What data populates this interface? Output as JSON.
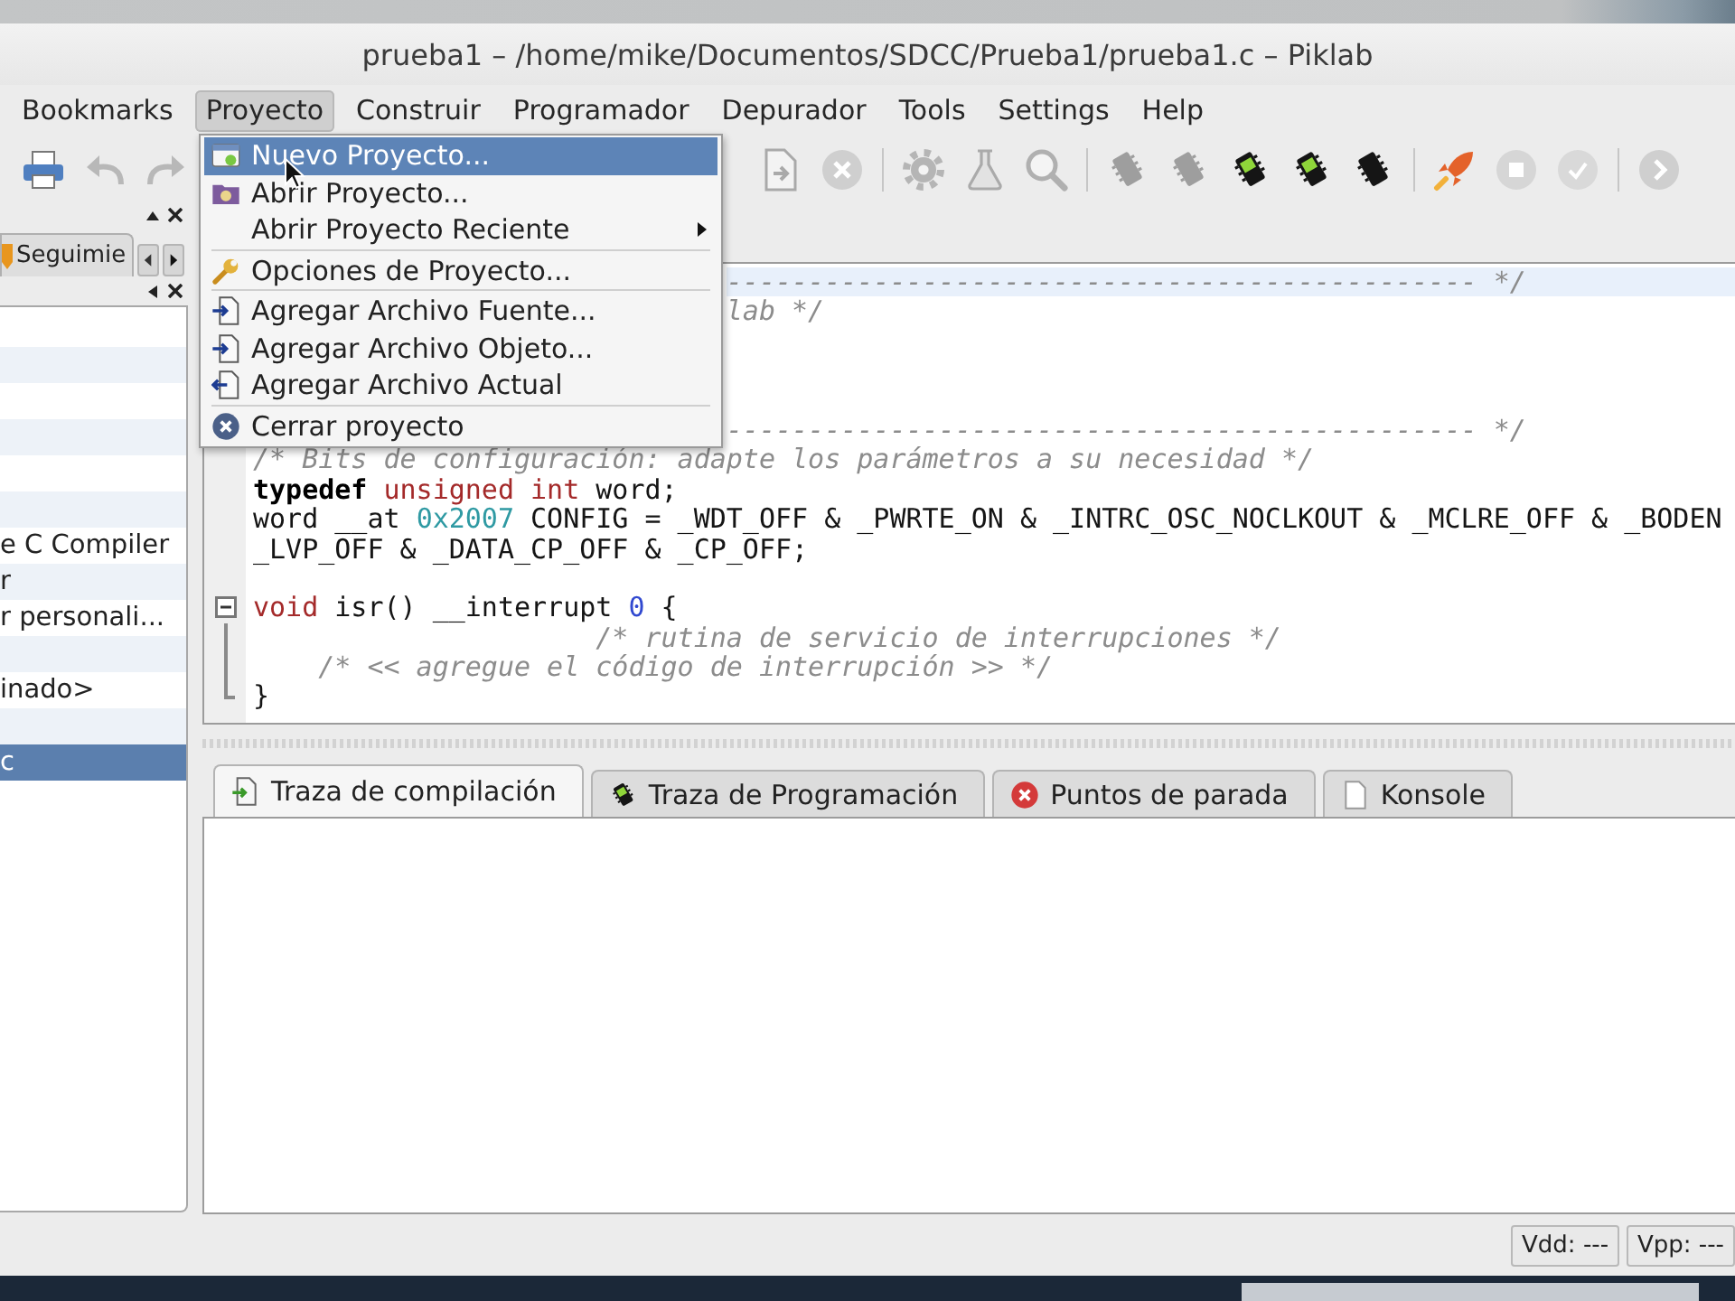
{
  "title_bar": {
    "title": "prueba1 – /home/mike/Documentos/SDCC/Prueba1/prueba1.c – Piklab"
  },
  "menu_bar": [
    {
      "label": "Bookmarks",
      "selected": false
    },
    {
      "label": "Proyecto",
      "selected": true
    },
    {
      "label": "Construir",
      "selected": false
    },
    {
      "label": "Programador",
      "selected": false
    },
    {
      "label": "Depurador",
      "selected": false
    },
    {
      "label": "Tools",
      "selected": false
    },
    {
      "label": "Settings",
      "selected": false
    },
    {
      "label": "Help",
      "selected": false
    }
  ],
  "toolbar": {
    "left": [
      {
        "kind": "print",
        "disabled": false
      },
      {
        "kind": "undo",
        "disabled": true
      },
      {
        "kind": "redo",
        "disabled": true
      }
    ],
    "right": [
      {
        "kind": "document",
        "disabled": true
      },
      {
        "kind": "circle_x",
        "disabled": true
      },
      {
        "kind": "separator"
      },
      {
        "kind": "gear",
        "disabled": true
      },
      {
        "kind": "flask",
        "disabled": true
      },
      {
        "kind": "search",
        "disabled": true
      },
      {
        "kind": "separator"
      },
      {
        "kind": "chip",
        "disabled": true
      },
      {
        "kind": "chip",
        "disabled": true
      },
      {
        "kind": "chip_label",
        "disabled": false
      },
      {
        "kind": "chip_label",
        "disabled": false
      },
      {
        "kind": "chip",
        "disabled": false
      },
      {
        "kind": "separator"
      },
      {
        "kind": "rocket",
        "disabled": false
      },
      {
        "kind": "circle_square",
        "disabled": true
      },
      {
        "kind": "circle_check",
        "disabled": true
      },
      {
        "kind": "separator"
      },
      {
        "kind": "circle_arrow",
        "disabled": true
      }
    ]
  },
  "project_menu": [
    {
      "kind": "item",
      "label": "Nuevo Proyecto...",
      "selected": true
    },
    {
      "kind": "item",
      "label": "Abrir Proyecto...",
      "selected": false
    },
    {
      "kind": "submenu",
      "label": "Abrir Proyecto Reciente",
      "selected": false
    },
    {
      "kind": "separator"
    },
    {
      "kind": "item",
      "label": "Opciones de Proyecto...",
      "selected": false
    },
    {
      "kind": "separator"
    },
    {
      "kind": "item",
      "label": "Agregar Archivo Fuente...",
      "selected": false
    },
    {
      "kind": "item",
      "label": "Agregar Archivo Objeto...",
      "selected": false
    },
    {
      "kind": "item",
      "label": "Agregar Archivo Actual",
      "selected": false
    },
    {
      "kind": "separator"
    },
    {
      "kind": "item",
      "label": "Cerrar proyecto",
      "selected": false
    }
  ],
  "side_panel": {
    "tab": {
      "label": "Seguimie"
    },
    "rows": [
      {
        "selected": false
      },
      {
        "selected": false
      },
      {
        "selected": false
      },
      {
        "selected": false
      },
      {
        "selected": false
      },
      {
        "selected": false
      },
      {
        "label": "e C Compiler",
        "selected": false
      },
      {
        "label": "r",
        "selected": false
      },
      {
        "label": "r personali...",
        "selected": false
      },
      {
        "selected": false
      },
      {
        "label": "inado>",
        "selected": false
      },
      {
        "selected": false
      },
      {
        "label": "c",
        "selected": true
      }
    ]
  },
  "editor": {
    "lines": [
      {
        "kind": "under_menu",
        "current": true,
        "tokens": [
          {
            "kind": "comment",
            "text": "---------------------------------------------- */"
          }
        ]
      },
      {
        "kind": "under_menu",
        "current": false,
        "tokens": [
          {
            "kind": "comment",
            "text": "lab */"
          }
        ]
      },
      {
        "kind": "blank",
        "current": false
      },
      {
        "kind": "blank",
        "current": false
      },
      {
        "kind": "blank",
        "current": false
      },
      {
        "kind": "under_menu",
        "current": false,
        "tokens": [
          {
            "kind": "comment",
            "text": "---------------------------------------------- */"
          }
        ]
      },
      {
        "kind": "code",
        "current": false,
        "tokens": [
          {
            "kind": "comment",
            "text": "/* Bits de configuración: adapte los parámetros a su necesidad */"
          }
        ]
      },
      {
        "kind": "code",
        "current": false,
        "tokens": [
          {
            "kind": "keyword",
            "text": "typedef "
          },
          {
            "kind": "type",
            "text": "unsigned int"
          },
          {
            "kind": "plain",
            "text": " word;"
          }
        ]
      },
      {
        "kind": "code",
        "current": false,
        "tokens": [
          {
            "kind": "plain",
            "text": "word __at "
          },
          {
            "kind": "hex",
            "text": "0x2007"
          },
          {
            "kind": "plain",
            "text": " CONFIG = _WDT_OFF & _PWRTE_ON & _INTRC_OSC_NOCLKOUT & _MCLRE_OFF & _BODEN"
          }
        ]
      },
      {
        "kind": "code",
        "current": false,
        "tokens": [
          {
            "kind": "plain",
            "text": "_LVP_OFF & _DATA_CP_OFF & _CP_OFF;"
          }
        ]
      },
      {
        "kind": "blank",
        "current": false
      },
      {
        "kind": "code",
        "current": false,
        "expanded": true,
        "tokens": [
          {
            "kind": "type",
            "text": "void"
          },
          {
            "kind": "plain",
            "text": " isr() __interrupt "
          },
          {
            "kind": "number",
            "text": "0"
          },
          {
            "kind": "plain",
            "text": " {"
          }
        ],
        "children": [
          {
            "kind": "code",
            "current": false,
            "tokens": [
              {
                "kind": "comment",
                "text": "                     /* rutina de servicio de interrupciones */"
              }
            ]
          },
          {
            "kind": "code",
            "current": false,
            "tokens": [
              {
                "kind": "comment",
                "text": "    /* << agregue el código de interrupción >> */"
              }
            ]
          },
          {
            "kind": "code",
            "current": false,
            "tokens": [
              {
                "kind": "plain",
                "text": "}"
              }
            ]
          }
        ]
      }
    ]
  },
  "output_panel": {
    "tabs": [
      {
        "label": "Traza de compilación",
        "selected": true
      },
      {
        "label": "Traza de Programación",
        "selected": false
      },
      {
        "label": "Puntos de parada",
        "selected": false
      },
      {
        "label": "Konsole",
        "selected": false
      }
    ]
  },
  "status_bar": {
    "fields": [
      "Vdd: ---",
      "Vpp: ---"
    ]
  }
}
